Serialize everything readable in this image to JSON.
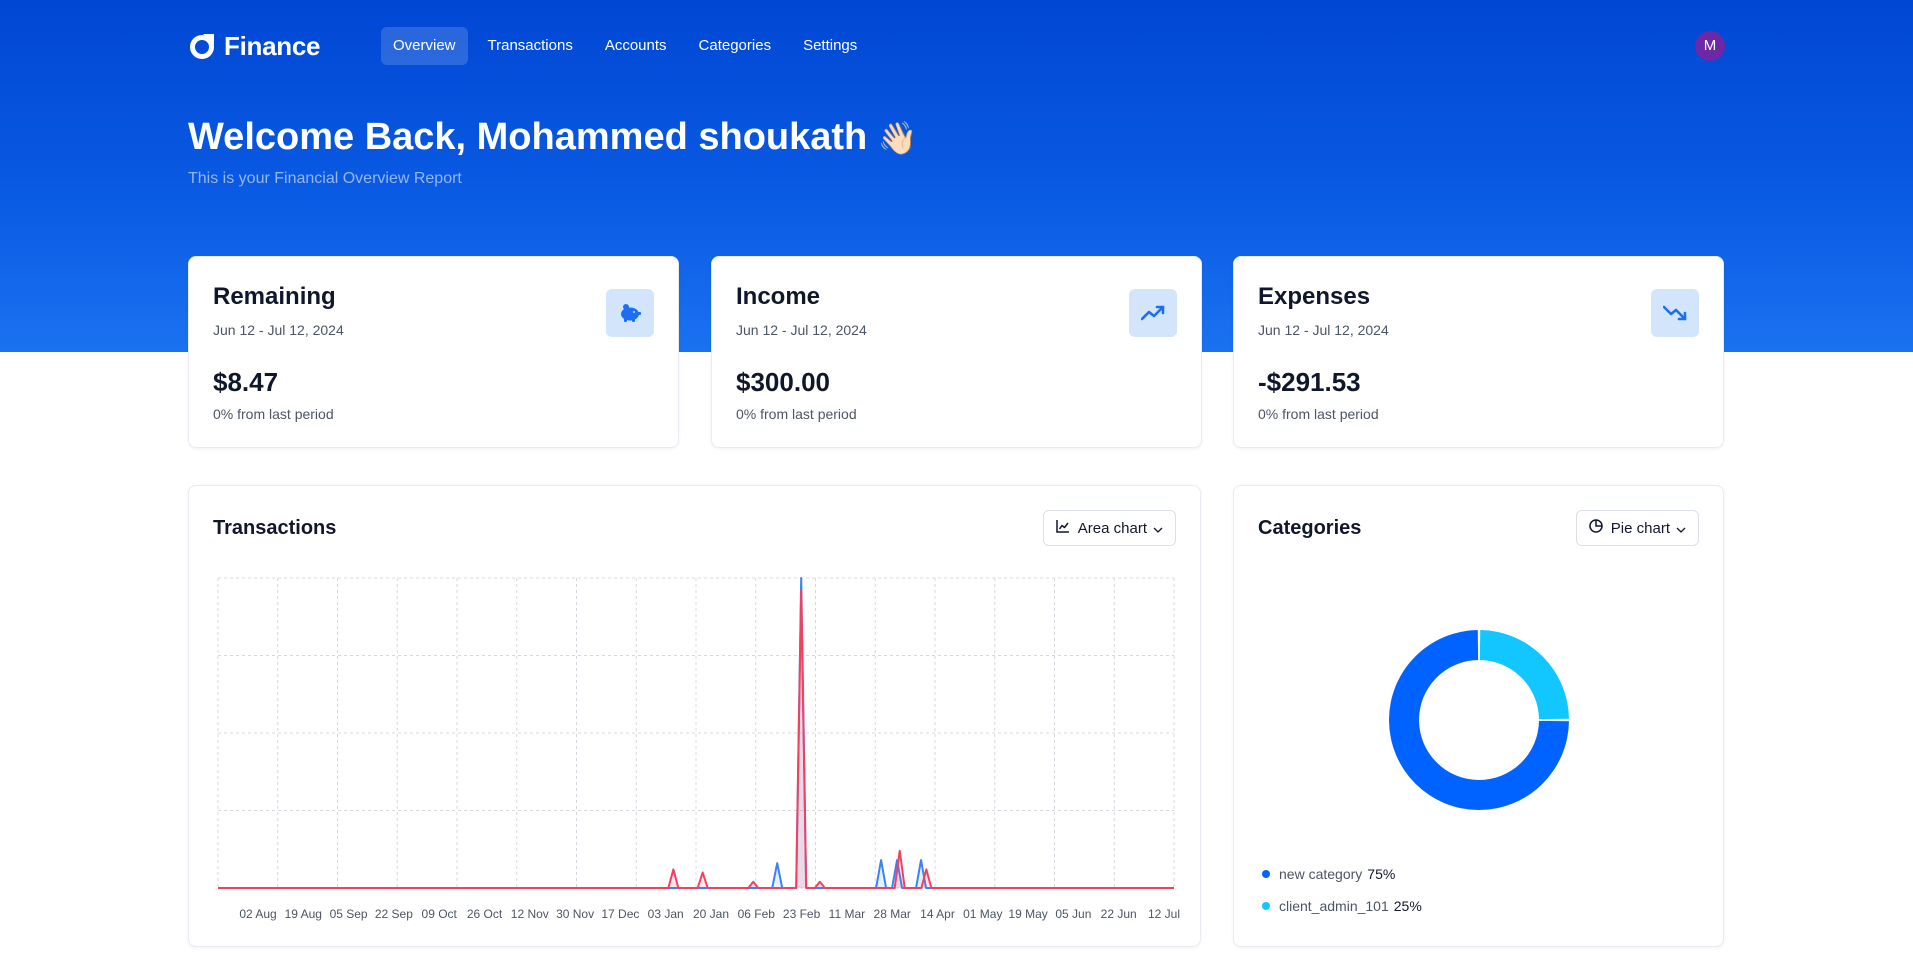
{
  "app": {
    "name": "Finance",
    "avatar_initial": "M"
  },
  "nav": {
    "items": [
      "Overview",
      "Transactions",
      "Accounts",
      "Categories",
      "Settings"
    ],
    "active": "Overview"
  },
  "welcome": {
    "title": "Welcome Back, Mohammed shoukath",
    "emoji": "👋🏻",
    "subtitle": "This is your Financial Overview Report"
  },
  "stats": [
    {
      "title": "Remaining",
      "range": "Jun 12 - Jul 12, 2024",
      "value": "$8.47",
      "delta": "0% from last period",
      "icon": "piggy-bank-icon"
    },
    {
      "title": "Income",
      "range": "Jun 12 - Jul 12, 2024",
      "value": "$300.00",
      "delta": "0% from last period",
      "icon": "trending-up-icon"
    },
    {
      "title": "Expenses",
      "range": "Jun 12 - Jul 12, 2024",
      "value": "-$291.53",
      "delta": "0% from last period",
      "icon": "trending-down-icon"
    }
  ],
  "transactions_panel": {
    "title": "Transactions",
    "chart_selector": "Area chart"
  },
  "categories_panel": {
    "title": "Categories",
    "chart_selector": "Pie chart"
  },
  "colors": {
    "income": "#3b82f6",
    "expenses": "#f43f5e",
    "cat1": "#0062ff",
    "cat2": "#12c6ff",
    "accent": "#0a5ae3"
  },
  "chart_data": [
    {
      "type": "area",
      "x_tick_labels": [
        "02 Aug",
        "19 Aug",
        "05 Sep",
        "22 Sep",
        "09 Oct",
        "26 Oct",
        "12 Nov",
        "30 Nov",
        "17 Dec",
        "03 Jan",
        "20 Jan",
        "06 Feb",
        "23 Feb",
        "11 Mar",
        "28 Mar",
        "14 Apr",
        "01 May",
        "19 May",
        "05 Jun",
        "22 Jun",
        "12 Jul"
      ],
      "x_range": [
        "2023-07-19",
        "2024-07-12"
      ],
      "grid": true,
      "series": [
        {
          "color": "#3b82f6",
          "points": [
            {
              "x": "2024-02-14",
              "y": 8
            },
            {
              "x": "2024-02-23",
              "y": 100
            },
            {
              "x": "2024-03-24",
              "y": 9
            },
            {
              "x": "2024-03-30",
              "y": 9
            },
            {
              "x": "2024-04-08",
              "y": 9
            }
          ]
        },
        {
          "color": "#f43f5e",
          "points": [
            {
              "x": "2024-01-06",
              "y": 6
            },
            {
              "x": "2024-01-17",
              "y": 5
            },
            {
              "x": "2024-02-05",
              "y": 2
            },
            {
              "x": "2024-02-23",
              "y": 96
            },
            {
              "x": "2024-03-01",
              "y": 2
            },
            {
              "x": "2024-03-31",
              "y": 12
            },
            {
              "x": "2024-04-10",
              "y": 6
            }
          ]
        }
      ]
    },
    {
      "type": "pie",
      "donut": true,
      "slices": [
        {
          "label": "new category",
          "value": 75,
          "color": "#0062ff"
        },
        {
          "label": "client_admin_101",
          "value": 25,
          "color": "#12c6ff"
        }
      ]
    }
  ]
}
